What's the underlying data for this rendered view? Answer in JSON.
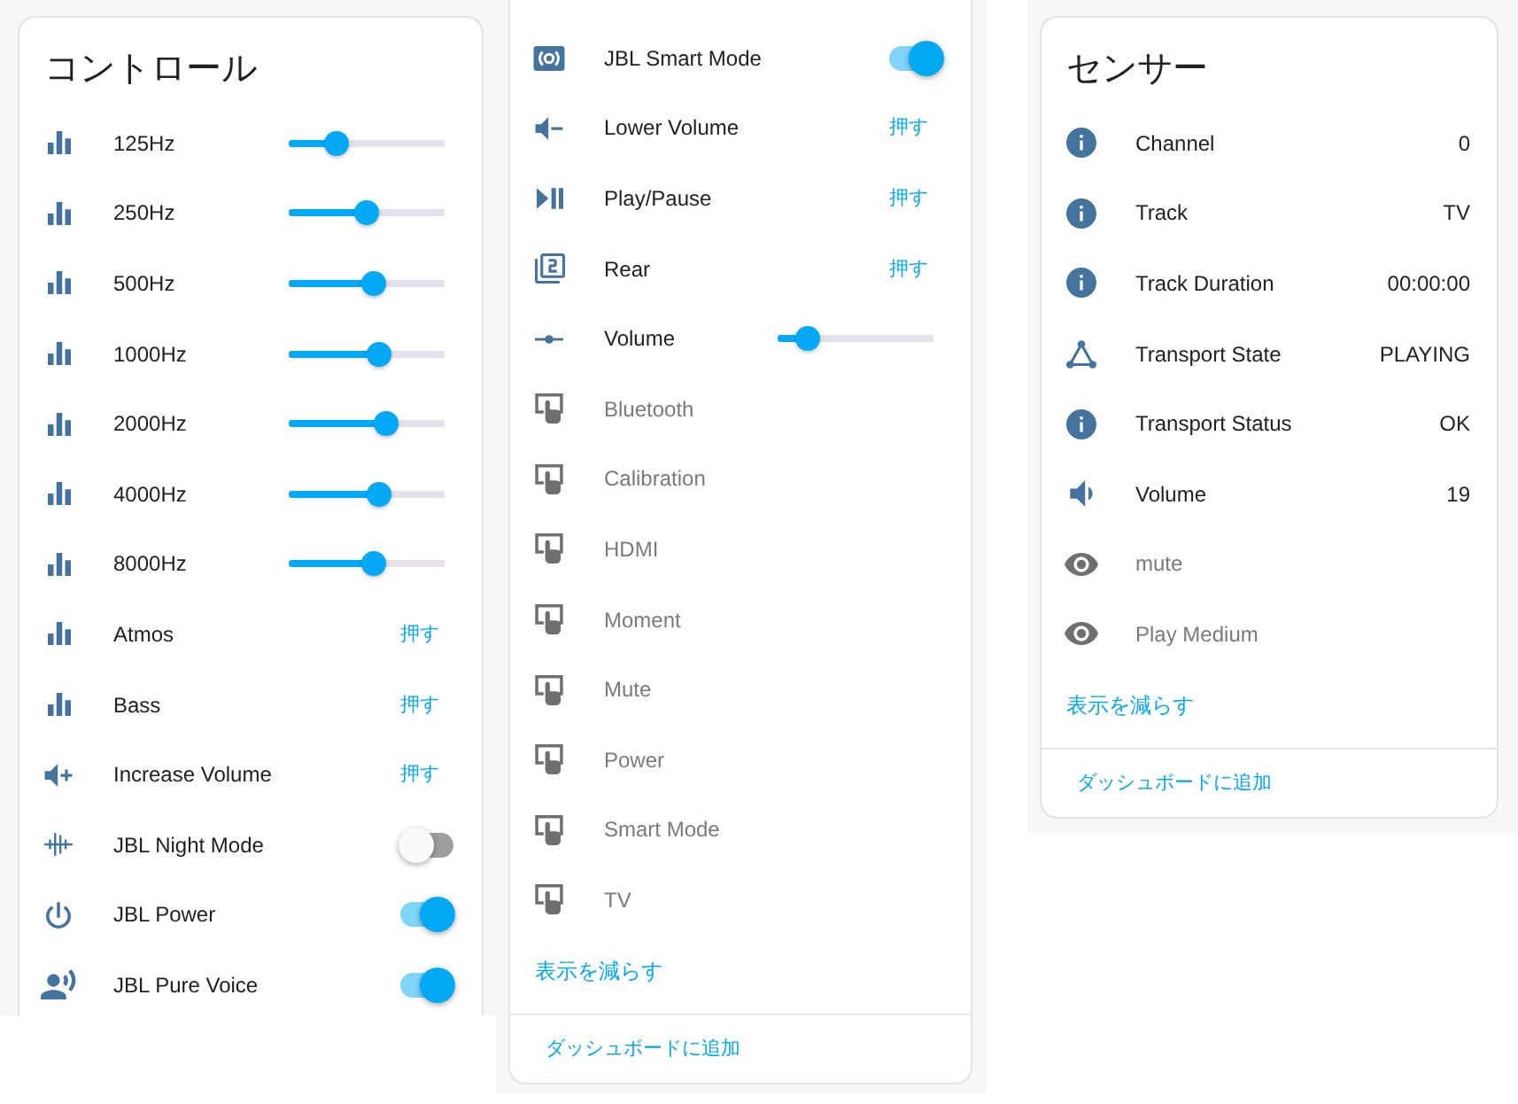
{
  "controls_card": {
    "title": "コントロール",
    "rows": [
      {
        "kind": "slider",
        "name": "125Hz",
        "level": 0.31
      },
      {
        "kind": "slider",
        "name": "250Hz",
        "level": 0.5
      },
      {
        "kind": "slider",
        "name": "500Hz",
        "level": 0.54
      },
      {
        "kind": "slider",
        "name": "1000Hz",
        "level": 0.58
      },
      {
        "kind": "slider",
        "name": "2000Hz",
        "level": 0.62
      },
      {
        "kind": "slider",
        "name": "4000Hz",
        "level": 0.58
      },
      {
        "kind": "slider",
        "name": "8000Hz",
        "level": 0.54
      },
      {
        "kind": "button",
        "name": "Atmos",
        "action": "押す"
      },
      {
        "kind": "button",
        "name": "Bass",
        "action": "押す"
      },
      {
        "kind": "button",
        "name": "Increase Volume",
        "action": "押す"
      },
      {
        "kind": "toggle",
        "name": "JBL Night Mode",
        "on": false
      },
      {
        "kind": "toggle",
        "name": "JBL Power",
        "on": true
      },
      {
        "kind": "toggle",
        "name": "JBL Pure Voice",
        "on": true
      }
    ]
  },
  "controls_card_continued": {
    "rows": [
      {
        "kind": "toggle",
        "name": "JBL Smart Mode",
        "on": true,
        "disabled": false
      },
      {
        "kind": "button",
        "name": "Lower Volume",
        "action": "押す",
        "disabled": false
      },
      {
        "kind": "button",
        "name": "Play/Pause",
        "action": "押す",
        "disabled": false
      },
      {
        "kind": "button",
        "name": "Rear",
        "action": "押す",
        "disabled": false
      },
      {
        "kind": "slider",
        "name": "Volume",
        "level": 0.19,
        "disabled": false
      },
      {
        "kind": "plain",
        "name": "Bluetooth",
        "disabled": true
      },
      {
        "kind": "plain",
        "name": "Calibration",
        "disabled": true
      },
      {
        "kind": "plain",
        "name": "HDMI",
        "disabled": true
      },
      {
        "kind": "plain",
        "name": "Moment",
        "disabled": true
      },
      {
        "kind": "plain",
        "name": "Mute",
        "disabled": true
      },
      {
        "kind": "plain",
        "name": "Power",
        "disabled": true
      },
      {
        "kind": "plain",
        "name": "Smart Mode",
        "disabled": true
      },
      {
        "kind": "plain",
        "name": "TV",
        "disabled": true
      }
    ],
    "show_less": "表示を減らす",
    "add_to_dashboard": "ダッシュボードに追加"
  },
  "sensors_card": {
    "title": "センサー",
    "rows": [
      {
        "name": "Channel",
        "value": "0",
        "disabled": false
      },
      {
        "name": "Track",
        "value": "TV",
        "disabled": false
      },
      {
        "name": "Track Duration",
        "value": "00:00:00",
        "disabled": false
      },
      {
        "name": "Transport State",
        "value": "PLAYING",
        "disabled": false
      },
      {
        "name": "Transport Status",
        "value": "OK",
        "disabled": false
      },
      {
        "name": "Volume",
        "value": "19",
        "disabled": false
      },
      {
        "name": "mute",
        "disabled": true
      },
      {
        "name": "Play Medium",
        "disabled": true
      }
    ],
    "show_less": "表示を減らす",
    "add_to_dashboard": "ダッシュボードに追加"
  }
}
